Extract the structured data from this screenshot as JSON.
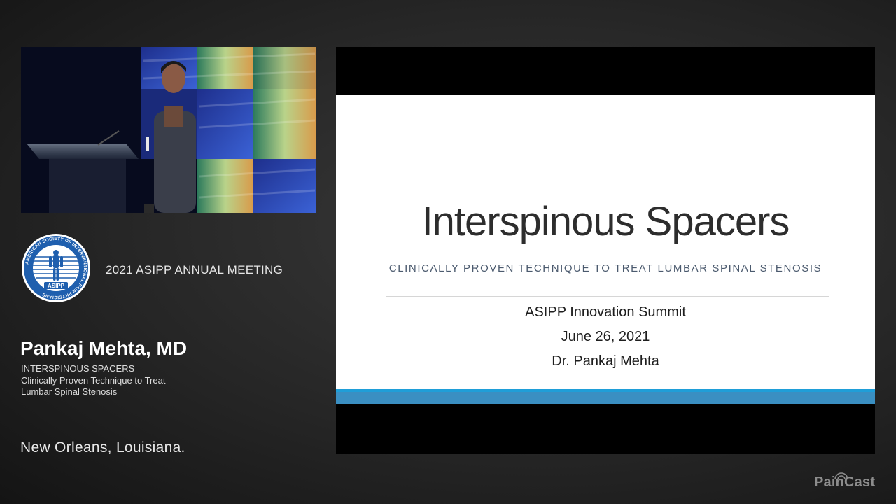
{
  "meeting": {
    "title": "2021 ASIPP ANNUAL MEETING",
    "logo_ring_text": "AMERICAN SOCIETY OF INTERVENTIONAL PAIN PHYSICIANS",
    "logo_badge": "ASIPP"
  },
  "presenter": {
    "name": "Pankaj Mehta, MD",
    "talk_lines": [
      "INTERSPINOUS SPACERS",
      "Clinically Proven Technique to Treat",
      "Lumbar Spinal Stenosis"
    ]
  },
  "location": "New Orleans, Louisiana.",
  "slide": {
    "title": "Interspinous Spacers",
    "subtitle": "CLINICALLY PROVEN TECHNIQUE TO TREAT LUMBAR SPINAL STENOSIS",
    "lines": [
      "ASIPP Innovation Summit",
      "June 26, 2021",
      "Dr. Pankaj Mehta"
    ]
  },
  "brand": {
    "name": "PainCast",
    "color": "#8c8c8c"
  },
  "colors": {
    "slide_bar": "#3a8fc2",
    "slide_accent": "#1f9ed8",
    "logo_blue": "#1f5fae"
  }
}
